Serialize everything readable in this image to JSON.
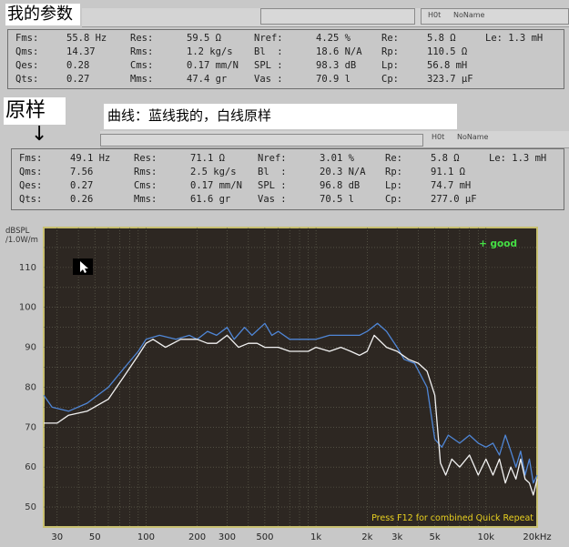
{
  "top_label": "我的参数",
  "top_panel": {
    "right_label_1": "H0t",
    "right_label_2": "NoName",
    "rows": [
      [
        "Fms:",
        "55.8 Hz",
        "Res:",
        "59.5 Ω",
        "Nref:",
        "4.25 %",
        "Re:",
        "5.8 Ω",
        "Le: 1.3 mH"
      ],
      [
        "Qms:",
        "14.37",
        "Rms:",
        "1.2 kg/s",
        "Bl  :",
        "18.6 N/A",
        "Rp:",
        "110.5 Ω",
        ""
      ],
      [
        "Qes:",
        "0.28",
        "Cms:",
        "0.17 mm/N",
        "SPL :",
        "98.3 dB",
        "Lp:",
        "56.8 mH",
        ""
      ],
      [
        "Qts:",
        "0.27",
        "Mms:",
        "47.4 gr",
        "Vas :",
        "70.9 l",
        "Cp:",
        "323.7 µF",
        ""
      ]
    ]
  },
  "original_label": "原样",
  "arrow_glyph": "↓",
  "caption": "曲线：蓝线我的，白线原样",
  "bottom_panel": {
    "right_label_1": "H0t",
    "right_label_2": "NoName",
    "rows": [
      [
        "Fms:",
        "49.1 Hz",
        "Res:",
        "71.1 Ω",
        "Nref:",
        "3.01 %",
        "Re:",
        "5.8 Ω",
        "Le: 1.3 mH"
      ],
      [
        "Qms:",
        "7.56",
        "Rms:",
        "2.5 kg/s",
        "Bl  :",
        "20.3 N/A",
        "Rp:",
        "91.1 Ω",
        ""
      ],
      [
        "Qes:",
        "0.27",
        "Cms:",
        "0.17 mm/N",
        "SPL :",
        "96.8 dB",
        "Lp:",
        "74.7 mH",
        ""
      ],
      [
        "Qts:",
        "0.26",
        "Mms:",
        "61.6 gr",
        "Vas :",
        "70.5 l",
        "Cp:",
        "277.0 µF",
        ""
      ]
    ]
  },
  "colors": {
    "plot_bg": "#2d2722",
    "plot_border": "#c8c070",
    "grid": "#6a6a58",
    "blue_series": "#4f86d6",
    "white_series": "#f2f2f2",
    "good_text": "#45e045",
    "footer_text": "#e8d020"
  },
  "chart_data": {
    "type": "line",
    "ylabel": "dBSPL\n/1.0W/m",
    "x_scale": "log",
    "xlim": [
      25,
      20000
    ],
    "ylim": [
      45,
      120
    ],
    "grid": true,
    "x_tick_labels": [
      "30",
      "50",
      "100",
      "200",
      "300",
      "500",
      "1k",
      "2k",
      "3k",
      "5k",
      "10k",
      "20kHz"
    ],
    "x_tick_values": [
      30,
      50,
      100,
      200,
      300,
      500,
      1000,
      2000,
      3000,
      5000,
      10000,
      20000
    ],
    "y_tick_values": [
      50,
      60,
      70,
      80,
      90,
      100,
      110
    ],
    "annotation_top_right": "+ good",
    "footer_note": "Press F12 for combined Quick Repeat",
    "series": [
      {
        "points": [
          [
            25,
            78
          ],
          [
            28,
            75
          ],
          [
            35,
            74
          ],
          [
            45,
            76
          ],
          [
            60,
            80
          ],
          [
            75,
            85
          ],
          [
            90,
            89
          ],
          [
            100,
            92
          ],
          [
            120,
            93
          ],
          [
            150,
            92
          ],
          [
            180,
            93
          ],
          [
            200,
            92
          ],
          [
            230,
            94
          ],
          [
            260,
            93
          ],
          [
            300,
            95
          ],
          [
            330,
            92
          ],
          [
            380,
            95
          ],
          [
            420,
            93
          ],
          [
            500,
            96
          ],
          [
            550,
            93
          ],
          [
            600,
            94
          ],
          [
            700,
            92
          ],
          [
            800,
            92
          ],
          [
            1000,
            92
          ],
          [
            1200,
            93
          ],
          [
            1500,
            93
          ],
          [
            1800,
            93
          ],
          [
            2000,
            94
          ],
          [
            2300,
            96
          ],
          [
            2600,
            94
          ],
          [
            3000,
            90
          ],
          [
            3300,
            87
          ],
          [
            3800,
            86
          ],
          [
            4500,
            80
          ],
          [
            5000,
            67
          ],
          [
            5500,
            65
          ],
          [
            6000,
            68
          ],
          [
            7000,
            66
          ],
          [
            8000,
            68
          ],
          [
            9000,
            66
          ],
          [
            10000,
            65
          ],
          [
            11000,
            66
          ],
          [
            12000,
            63
          ],
          [
            13000,
            68
          ],
          [
            14000,
            64
          ],
          [
            15000,
            60
          ],
          [
            16000,
            64
          ],
          [
            17000,
            58
          ],
          [
            18000,
            62
          ],
          [
            19000,
            56
          ],
          [
            20000,
            58
          ]
        ]
      },
      {
        "points": [
          [
            25,
            71
          ],
          [
            30,
            71
          ],
          [
            35,
            73
          ],
          [
            45,
            74
          ],
          [
            60,
            77
          ],
          [
            75,
            83
          ],
          [
            90,
            88
          ],
          [
            100,
            91
          ],
          [
            110,
            92
          ],
          [
            130,
            90
          ],
          [
            160,
            92
          ],
          [
            200,
            92
          ],
          [
            230,
            91
          ],
          [
            260,
            91
          ],
          [
            300,
            93
          ],
          [
            350,
            90
          ],
          [
            400,
            91
          ],
          [
            450,
            91
          ],
          [
            500,
            90
          ],
          [
            600,
            90
          ],
          [
            700,
            89
          ],
          [
            800,
            89
          ],
          [
            900,
            89
          ],
          [
            1000,
            90
          ],
          [
            1200,
            89
          ],
          [
            1400,
            90
          ],
          [
            1600,
            89
          ],
          [
            1800,
            88
          ],
          [
            2000,
            89
          ],
          [
            2200,
            93
          ],
          [
            2600,
            90
          ],
          [
            3000,
            89
          ],
          [
            3500,
            87
          ],
          [
            4000,
            86
          ],
          [
            4500,
            84
          ],
          [
            5000,
            78
          ],
          [
            5400,
            61
          ],
          [
            5800,
            58
          ],
          [
            6300,
            62
          ],
          [
            7000,
            60
          ],
          [
            8000,
            63
          ],
          [
            9000,
            58
          ],
          [
            10000,
            62
          ],
          [
            11000,
            58
          ],
          [
            12000,
            62
          ],
          [
            13000,
            56
          ],
          [
            14000,
            60
          ],
          [
            15000,
            57
          ],
          [
            16000,
            62
          ],
          [
            17000,
            57
          ],
          [
            18000,
            56
          ],
          [
            19000,
            53
          ],
          [
            20000,
            57
          ]
        ]
      }
    ]
  }
}
